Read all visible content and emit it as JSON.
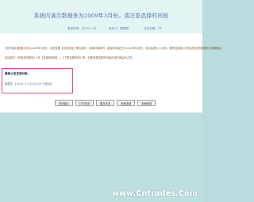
{
  "page": {
    "title": "系统内演示数据多为2009年3月份，请注意选择时间段",
    "meta": {
      "publish_time": "发布时间：2010-1-23",
      "publisher": "发布人：管理员",
      "views": "点击次数：53"
    },
    "paragraphs": [
      "写的内容均数据大多为2009年3月份，请您查看【业务查询】等功能时，选择时间段时，起始时间定在为 2009年3月份，否则会报为 0 月份，要附加到新公司测试查询的数据作业数据展示。",
      "包括其它一些相关的都用1-3年【多媒体视频】—【下载全额查询】等，也要设置选择时间段在该时间区间之内。"
    ],
    "notice": {
      "title": "最新公告发送对象：",
      "line": "管理员 【2010-1-3 15:21:53 已查阅】"
    },
    "buttons": {
      "b1": "关闭窗口",
      "b2": "打印本页",
      "b3": "保存本页",
      "b4": "页面顶部",
      "b5": "页面底部"
    },
    "watermark": "www.Cntrades.Com",
    "colors": {
      "title": "#5b74b1",
      "notice_border": "#d94e8b",
      "background_band": "#bde0df",
      "header_band": "#e2f4f4"
    }
  }
}
